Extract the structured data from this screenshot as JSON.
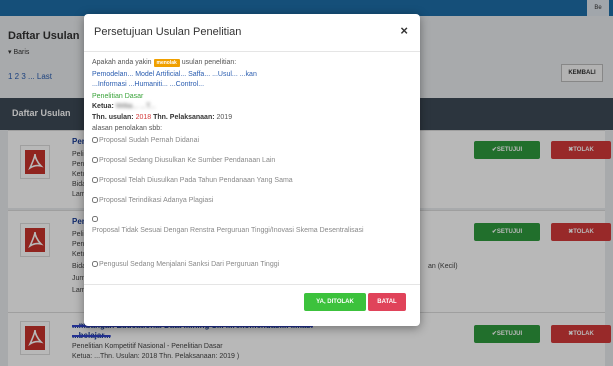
{
  "page": {
    "title": "Daftar Usulan",
    "show_label": "Baris",
    "pager_text": "1 2 3 ... Last",
    "back_button": "KEMBALI",
    "table_header": "Daftar Usulan",
    "approve_label": "SETUJUI",
    "reject_label": "TOLAK",
    "avatar_label": "Be",
    "rows": [
      {
        "title": "Pen... ...nal",
        "line1": "Peli...",
        "line2": "Pen...",
        "line3": "Ketu...",
        "line4": "Bida...",
        "line5": "Lam..."
      },
      {
        "title": "Pen... ...ditas",
        "line1": "Peli...",
        "line2": "Pen...",
        "line3": "Ketu...",
        "line4": "Bida...",
        "extra": "Jum...",
        "line5": "Lam...",
        "right_text": "an (Kecil)"
      },
      {
        "title": "...mbangan Educational Data Mining S... ...rekomendasi... ...kasi",
        "title2": "...belajar...",
        "line1": "Penelitian Kompetitif Nasional - Penelitian Dasar",
        "line2": "Ketua: ...Thn. Usulan: 2018 Thn. Pelaksanaan: 2019 )"
      }
    ]
  },
  "modal": {
    "title": "Persetujuan Usulan Penelitian",
    "close_symbol": "×",
    "question_prefix": "Apakah anda yakin",
    "badge": "menolak",
    "question_suffix": "usulan penelitian:",
    "proposal_title_1": "Pemodelan... Model Artificial... Saffa... ...Usul... ...kan",
    "proposal_title_2": "...Informasi ...Humaniti... ...Control...",
    "scheme": "Penelitian Dasar",
    "ketua_label": "Ketua:",
    "ketua_value": "Willia... ...T...",
    "thn_usulan_label": "Thn. usulan:",
    "thn_usulan_value": "2018",
    "thn_pelaksanaan_label": "Thn. Pelaksanaan:",
    "thn_pelaksanaan_value": "2019",
    "reason_label": "alasan penolakan sbb:",
    "options": [
      "Proposal Sudah Pernah Didanai",
      "Proposal Sedang Diusulkan Ke Sumber Pendanaan Lain",
      "Proposal Telah Diusulkan Pada Tahun Pendanaan Yang Sama",
      "Proposal Terindikasi Adanya Plagiasi",
      "Proposal Tidak Sesuai Dengan Renstra Perguruan Tinggi/Inovasi Skema Desentralisasi",
      "Pengusul Sedang Menjalani Sanksi Dari Perguruan Tinggi"
    ],
    "confirm_button": "YA, DITOLAK",
    "cancel_button": "BATAL"
  },
  "colors": {
    "approve": "#2e9a3e",
    "reject": "#d33a3a",
    "confirm": "#3cc23c",
    "cancel": "#e0435a",
    "badge": "#f0a000"
  }
}
